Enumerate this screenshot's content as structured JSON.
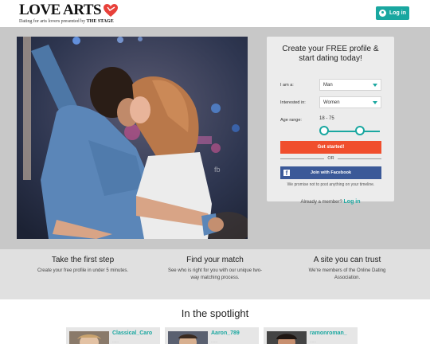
{
  "header": {
    "logo_text": "LOVE ARTS",
    "tagline_prefix": "Dating for arts lovers presented by ",
    "tagline_brand": "THE STAGE",
    "login_label": "Log in"
  },
  "signup": {
    "title_line1": "Create your FREE profile &",
    "title_line2": "start dating today!",
    "i_am_label": "I am a:",
    "i_am_value": "Man",
    "interested_label": "Interested in:",
    "interested_value": "Women",
    "age_label": "Age range:",
    "age_value": "18 - 75",
    "get_started_label": "Get started!",
    "or_label": "OR",
    "facebook_label": "Join with Facebook",
    "promise_text": "We promise not to post anything on your timeline.",
    "already_member_text": "Already a member?",
    "login_link": "Log in"
  },
  "features": [
    {
      "title": "Take the first step",
      "text": "Create your free profile in under 5 minutes."
    },
    {
      "title": "Find your match",
      "text": "See who is right for you with our unique two-way matching process."
    },
    {
      "title": "A site you can trust",
      "text": "We're members of the Online Dating Association."
    }
  ],
  "spotlight": {
    "title": "In the spotlight",
    "profiles": [
      {
        "name": "Classical_Caro"
      },
      {
        "name": "Aaron_789"
      },
      {
        "name": "ramonroman_"
      }
    ]
  },
  "colors": {
    "accent": "#1aa7a0",
    "cta": "#f04e2d",
    "facebook": "#3b5998",
    "logo_heart": "#e8413a"
  }
}
